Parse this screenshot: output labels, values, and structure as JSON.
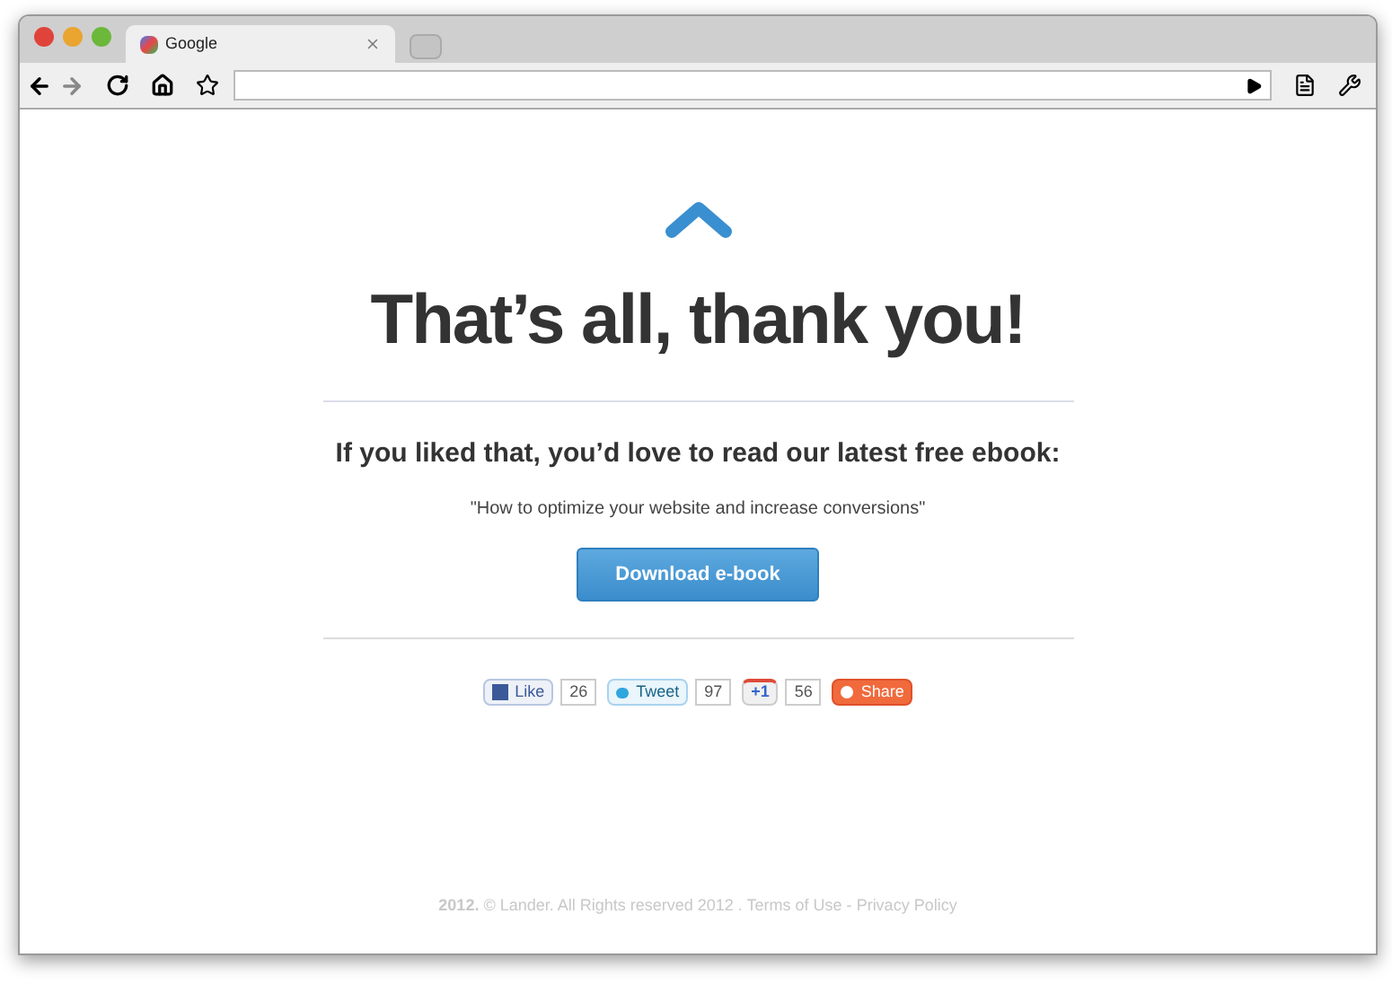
{
  "tabs": [
    {
      "title": "Google",
      "selected": true
    }
  ],
  "page": {
    "title": "That’s all, thank you!",
    "subtitle": "If you liked that, you’d love to read our latest free ebook:",
    "book": "\"How to optimize your website and increase conversions\"",
    "download": "Download e-book",
    "social": [
      {
        "kind": "like",
        "label": "Like",
        "count": "26"
      },
      {
        "kind": "tweet",
        "label": "Tweet",
        "count": "97"
      },
      {
        "kind": "plusone",
        "label": "+1",
        "count": "56"
      },
      {
        "kind": "share",
        "label": "Share"
      }
    ],
    "footer": {
      "text": "**2012.** © Lander. All Rights reserved 2012 .",
      "links": [
        "Terms of Use",
        "Privacy Policy"
      ],
      "separator": "-"
    }
  }
}
